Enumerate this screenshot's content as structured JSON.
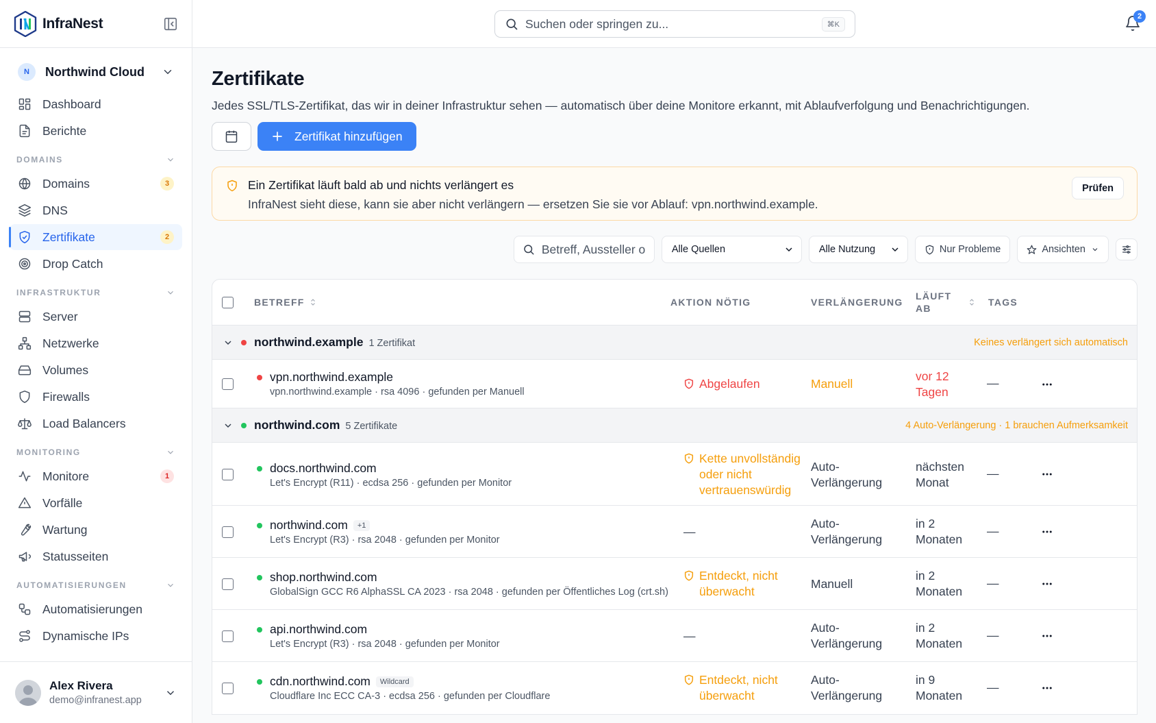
{
  "brand": {
    "name": "InfraNest"
  },
  "org": {
    "initial": "N",
    "name": "Northwind Cloud"
  },
  "nav": {
    "dashboard": "Dashboard",
    "reports": "Berichte",
    "sec_domains": "DOMAINS",
    "domains": "Domains",
    "domains_badge": "3",
    "dns": "DNS",
    "certs": "Zertifikate",
    "certs_badge": "2",
    "dropcatch": "Drop Catch",
    "sec_infra": "INFRASTRUKTUR",
    "server": "Server",
    "networks": "Netzwerke",
    "volumes": "Volumes",
    "firewalls": "Firewalls",
    "lb": "Load Balancers",
    "sec_monitoring": "MONITORING",
    "monitors": "Monitore",
    "monitors_badge": "1",
    "incidents": "Vorfälle",
    "maintenance": "Wartung",
    "status": "Statusseiten",
    "sec_auto": "AUTOMATISIERUNGEN",
    "automations": "Automatisierungen",
    "dynips": "Dynamische IPs"
  },
  "user": {
    "name": "Alex Rivera",
    "email": "demo@infranest.app"
  },
  "topbar": {
    "search_placeholder": "Suchen oder springen zu...",
    "shortcut": "⌘K",
    "notif_count": "2"
  },
  "page": {
    "title": "Zertifikate",
    "subtitle": "Jedes SSL/TLS-Zertifikat, das wir in deiner Infrastruktur sehen — automatisch über deine Monitore erkannt, mit Ablaufverfolgung und Benachrichtigungen.",
    "add_button": "Zertifikat hinzufügen"
  },
  "alert": {
    "title": "Ein Zertifikat läuft bald ab und nichts verlängert es",
    "text": "InfraNest sieht diese, kann sie aber nicht verlängern — ersetzen Sie sie vor Ablauf: vpn.northwind.example.",
    "button": "Prüfen"
  },
  "filters": {
    "search_placeholder": "Betreff, Aussteller o",
    "source": "Alle Quellen",
    "usage": "Alle Nutzung",
    "problems": "Nur Probleme",
    "views": "Ansichten"
  },
  "table": {
    "headers": {
      "subject": "BETREFF",
      "action": "AKTION NÖTIG",
      "renewal": "VERLÄNGERUNG",
      "expires_1": "LÄUFT",
      "expires_2": "AB",
      "tags": "TAGS"
    },
    "groups": [
      {
        "name": "northwind.example",
        "count": "1 Zertifikat",
        "note": "Keines verlängert sich automatisch",
        "color": "#ef4444",
        "rows": [
          {
            "name": "vpn.northwind.example",
            "tag": "",
            "meta": "vpn.northwind.example · rsa 4096 · gefunden per Manuell",
            "action_1": "Abgelaufen",
            "action_2": "",
            "action_3": "",
            "renew_1": "Manuell",
            "renew_2": "",
            "exp_1": "vor 12",
            "exp_2": "Tagen",
            "tags": "—",
            "dot": "#ef4444"
          }
        ]
      },
      {
        "name": "northwind.com",
        "count": "5 Zertifikate",
        "note": "4 Auto-Verlängerung · 1 brauchen Aufmerksamkeit",
        "color": "#22c55e",
        "rows": [
          {
            "name": "docs.northwind.com",
            "tag": "",
            "meta": "Let's Encrypt (R11) · ecdsa 256 · gefunden per Monitor",
            "action_1": "Kette unvollständig",
            "action_2": "oder nicht",
            "action_3": "vertrauenswürdig",
            "renew_1": "Auto-",
            "renew_2": "Verlängerung",
            "exp_1": "nächsten",
            "exp_2": "Monat",
            "tags": "—",
            "dot": "#22c55e"
          },
          {
            "name": "northwind.com",
            "tag": "+1",
            "meta": "Let's Encrypt (R3) · rsa 2048 · gefunden per Monitor",
            "action_1": "—",
            "action_2": "",
            "action_3": "",
            "renew_1": "Auto-",
            "renew_2": "Verlängerung",
            "exp_1": "in 2",
            "exp_2": "Monaten",
            "tags": "—",
            "dot": "#22c55e"
          },
          {
            "name": "shop.northwind.com",
            "tag": "",
            "meta": "GlobalSign GCC R6 AlphaSSL CA 2023 · rsa 2048 · gefunden per Öffentliches Log (crt.sh)",
            "action_1": "Entdeckt, nicht",
            "action_2": "überwacht",
            "action_3": "",
            "renew_1": "Manuell",
            "renew_2": "",
            "exp_1": "in 2",
            "exp_2": "Monaten",
            "tags": "—",
            "dot": "#22c55e"
          },
          {
            "name": "api.northwind.com",
            "tag": "",
            "meta": "Let's Encrypt (R3) · rsa 2048 · gefunden per Monitor",
            "action_1": "—",
            "action_2": "",
            "action_3": "",
            "renew_1": "Auto-",
            "renew_2": "Verlängerung",
            "exp_1": "in 2",
            "exp_2": "Monaten",
            "tags": "—",
            "dot": "#22c55e"
          },
          {
            "name": "cdn.northwind.com",
            "tag": "Wildcard",
            "meta": "Cloudflare Inc ECC CA-3 · ecdsa 256 · gefunden per Cloudflare",
            "action_1": "Entdeckt, nicht",
            "action_2": "überwacht",
            "action_3": "",
            "renew_1": "Auto-",
            "renew_2": "Verlängerung",
            "exp_1": "in 9",
            "exp_2": "Monaten",
            "tags": "—",
            "dot": "#22c55e"
          }
        ]
      }
    ]
  },
  "colors": {
    "accent": "#3b82f6",
    "danger": "#ef4444",
    "warning": "#f59e0b",
    "success": "#22c55e"
  }
}
